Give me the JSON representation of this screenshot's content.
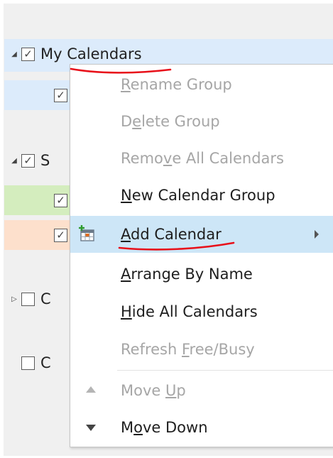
{
  "tree": {
    "items": [
      {
        "label": "My Calendars",
        "expanded": true,
        "checked": true
      },
      {
        "label": "S",
        "expanded": true,
        "checked": true
      },
      {
        "label": "C",
        "expanded": false,
        "checked": false
      },
      {
        "label": "C",
        "checked": false
      }
    ],
    "child_check_glyph": "✓",
    "colors": {
      "selected": "#dcebfb",
      "green": "#d4edbe",
      "peach": "#fde0cc"
    }
  },
  "menu": {
    "items": [
      {
        "label": "Rename Group",
        "mnemonic": "R",
        "enabled": false
      },
      {
        "label": "Delete Group",
        "mnemonic": "e",
        "enabled": false
      },
      {
        "label": "Remove All Calendars",
        "mnemonic": "v",
        "enabled": false
      },
      {
        "label": "New Calendar Group",
        "mnemonic": "N",
        "enabled": true
      },
      {
        "label": "Add Calendar",
        "mnemonic": "A",
        "enabled": true,
        "icon": "add-calendar-icon",
        "has_submenu": true,
        "highlighted": true
      },
      {
        "label": "Arrange By Name",
        "mnemonic": "A",
        "enabled": true
      },
      {
        "label": "Hide All Calendars",
        "mnemonic": "H",
        "enabled": true
      },
      {
        "label": "Refresh Free/Busy",
        "mnemonic": "F",
        "enabled": false
      },
      {
        "label": "Move Up",
        "mnemonic": "U",
        "enabled": false,
        "icon": "move-up-icon"
      },
      {
        "label": "Move Down",
        "mnemonic": "o",
        "enabled": true,
        "icon": "move-down-icon"
      }
    ]
  },
  "annotation_color": "#e8101a"
}
